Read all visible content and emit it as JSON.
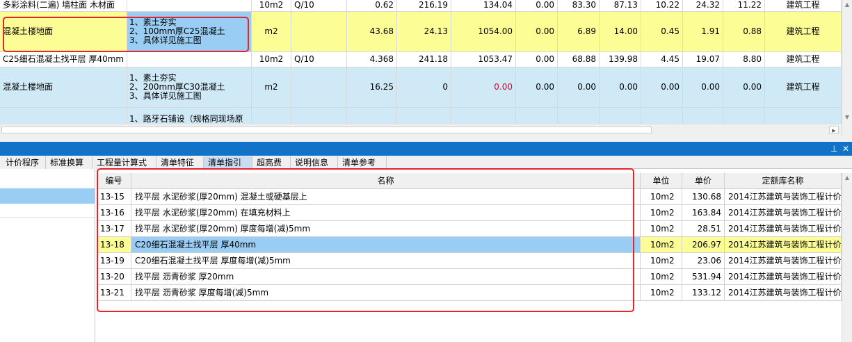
{
  "upper_grid": {
    "rows": [
      {
        "name": "多彩涂料(二遍) 墙柱面 木材面",
        "feature": "",
        "unit": "10m2",
        "code": "Q/10",
        "qty": "0.62",
        "price": "216.19",
        "total": "134.04",
        "c1": "0.00",
        "c2": "83.30",
        "c3": "87.13",
        "c4": "10.22",
        "c5": "24.32",
        "c6": "11.22",
        "category": "建筑工程"
      },
      {
        "name": "混凝土楼地面",
        "feature": "1、素土夯实\n2、100mm厚C25混凝土\n3、具体详见施工图",
        "unit": "m2",
        "code": "",
        "qty": "43.68",
        "price": "24.13",
        "total": "1054.00",
        "c1": "0.00",
        "c2": "6.89",
        "c3": "14.00",
        "c4": "0.45",
        "c5": "1.91",
        "c6": "0.88",
        "category": "建筑工程"
      },
      {
        "name": "C25细石混凝土找平层 厚40mm",
        "feature": "",
        "unit": "10m2",
        "code": "Q/10",
        "qty": "4.368",
        "price": "241.18",
        "total": "1053.47",
        "c1": "0.00",
        "c2": "68.88",
        "c3": "139.98",
        "c4": "4.45",
        "c5": "19.07",
        "c6": "8.80",
        "category": "建筑工程"
      },
      {
        "name": "混凝土楼地面",
        "feature": "1、素土夯实\n2、200mm厚C30混凝土\n3、具体详见施工图",
        "unit": "m2",
        "code": "",
        "qty": "16.25",
        "price": "0",
        "total": "0.00",
        "c1": "0.00",
        "c2": "0.00",
        "c3": "0.00",
        "c4": "0.00",
        "c5": "0.00",
        "c6": "0.00",
        "category": "建筑工程"
      },
      {
        "name": "",
        "feature": "1、路牙石铺设（规格同现场原",
        "unit": "",
        "code": "",
        "qty": "",
        "price": "",
        "total": "",
        "c1": "",
        "c2": "",
        "c3": "",
        "c4": "",
        "c5": "",
        "c6": "",
        "category": ""
      }
    ]
  },
  "panel": {
    "pin_icon": "⊥",
    "close_icon": "✕"
  },
  "tabs": [
    {
      "label": "计价程序"
    },
    {
      "label": "标准换算"
    },
    {
      "label": "工程量计算式"
    },
    {
      "label": "清单特征"
    },
    {
      "label": "清单指引"
    },
    {
      "label": "超高费"
    },
    {
      "label": "说明信息"
    },
    {
      "label": "清单参考"
    }
  ],
  "lower_grid": {
    "headers": {
      "code": "编号",
      "name": "名称",
      "unit": "单位",
      "price": "单价",
      "library": "定额库名称"
    },
    "rows": [
      {
        "code": "13-15",
        "name": "找平层 水泥砂浆(厚20mm) 混凝土或硬基层上",
        "unit": "10m2",
        "price": "130.68",
        "library": "2014江苏建筑与装饰工程计价..."
      },
      {
        "code": "13-16",
        "name": "找平层 水泥砂浆(厚20mm) 在填充材料上",
        "unit": "10m2",
        "price": "163.84",
        "library": "2014江苏建筑与装饰工程计价..."
      },
      {
        "code": "13-17",
        "name": "找平层 水泥砂浆(厚20mm) 厚度每增(减)5mm",
        "unit": "10m2",
        "price": "28.51",
        "library": "2014江苏建筑与装饰工程计价..."
      },
      {
        "code": "13-18",
        "name": "C20细石混凝土找平层 厚40mm",
        "unit": "10m2",
        "price": "206.97",
        "library": "2014江苏建筑与装饰工程计价..."
      },
      {
        "code": "13-19",
        "name": "C20细石混凝土找平层 厚度每增(减)5mm",
        "unit": "10m2",
        "price": "23.06",
        "library": "2014江苏建筑与装饰工程计价..."
      },
      {
        "code": "13-20",
        "name": "找平层 沥青砂浆 厚20mm",
        "unit": "10m2",
        "price": "531.94",
        "library": "2014江苏建筑与装饰工程计价..."
      },
      {
        "code": "13-21",
        "name": "找平层 沥青砂浆 厚度每增(减)5mm",
        "unit": "10m2",
        "price": "133.12",
        "library": "2014江苏建筑与装饰工程计价..."
      }
    ]
  },
  "colors": {
    "yellow_row": "#fdfd96",
    "light_blue_row": "#cfe9f7",
    "selected_blue": "#99cdf4",
    "title_bar_blue": "#1173c8",
    "highlight_red": "#e8232b",
    "negative_red": "#e0002a"
  }
}
